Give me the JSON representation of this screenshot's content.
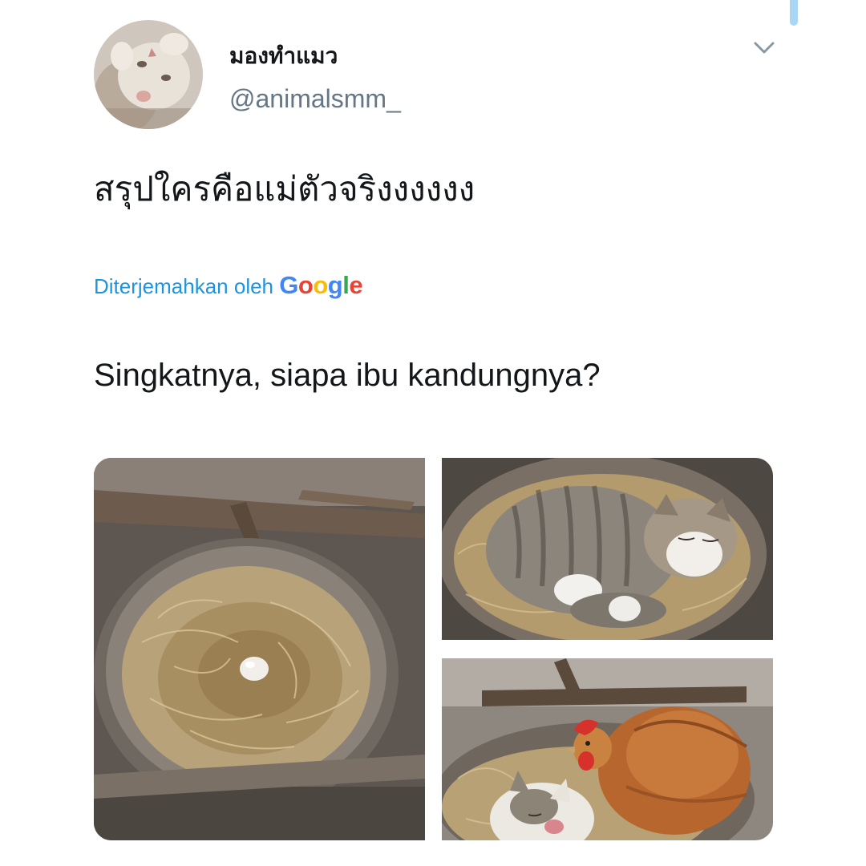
{
  "tweet": {
    "display_name": "มองทำแมว",
    "handle": "@animalsmm_",
    "text": "สรุปใครคือแม่ตัวจริงงงงงง",
    "translated_by_label": "Diterjemahkan oleh",
    "translation_provider": "Google",
    "translation": "Singkatnya, siapa ibu kandungnya?"
  },
  "colors": {
    "link_blue": "#1b95e0",
    "handle_gray": "#657786",
    "google_blue": "#4285f4",
    "google_red": "#ea4335",
    "google_yellow": "#fbbc05",
    "google_green": "#34a853"
  },
  "icons": {
    "caret": "chevron-down-icon",
    "avatar": "cat-avatar"
  }
}
